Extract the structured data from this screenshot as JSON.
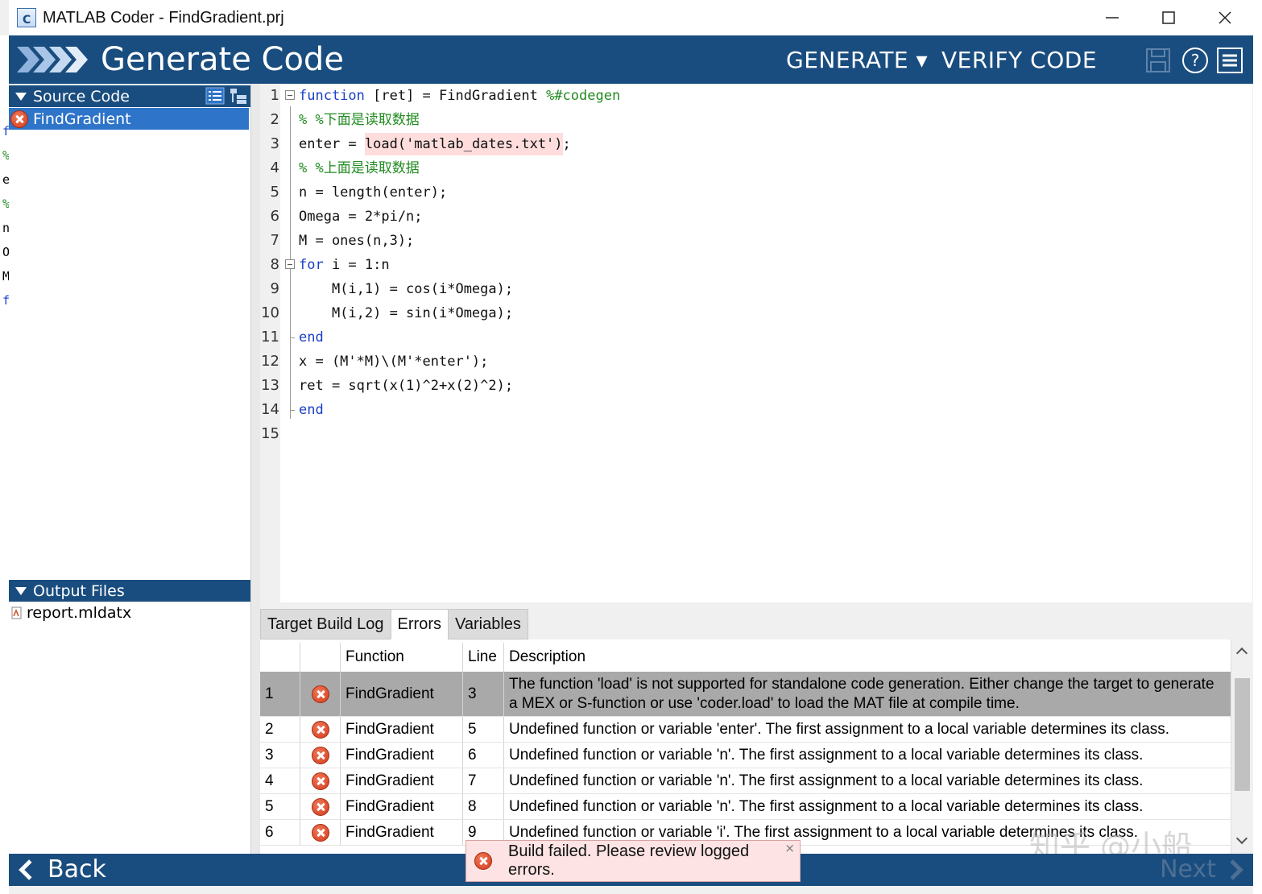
{
  "window": {
    "title": "MATLAB Coder - FindGradient.prj",
    "controls": [
      "minimize-icon",
      "maximize-icon",
      "close-icon"
    ]
  },
  "header": {
    "title": "Generate Code",
    "generate_label": "GENERATE ▾",
    "verify_label": "VERIFY CODE",
    "icons": [
      "save-icon",
      "help-icon",
      "menu-icon"
    ]
  },
  "source_code": {
    "header": "Source Code",
    "files": [
      {
        "name": "FindGradient",
        "status": "error",
        "selected": true
      }
    ]
  },
  "output_files": {
    "header": "Output Files",
    "files": [
      {
        "name": "report.mldatx"
      }
    ]
  },
  "editor": {
    "lines": [
      {
        "n": "1",
        "parts": [
          {
            "t": "function",
            "c": "kw"
          },
          {
            "t": " [ret] = FindGradient ",
            "c": ""
          },
          {
            "t": "%#codegen",
            "c": "cm"
          }
        ],
        "fold": "start"
      },
      {
        "n": "2",
        "parts": [
          {
            "t": "% %下面是读取数据",
            "c": "cm"
          }
        ]
      },
      {
        "n": "3",
        "parts": [
          {
            "t": "enter = ",
            "c": ""
          },
          {
            "t": "load('matlab_dates.txt')",
            "c": "hl"
          },
          {
            "t": ";",
            "c": ""
          }
        ]
      },
      {
        "n": "4",
        "parts": [
          {
            "t": "% %上面是读取数据",
            "c": "cm"
          }
        ]
      },
      {
        "n": "5",
        "parts": [
          {
            "t": "n = length(enter);",
            "c": ""
          }
        ]
      },
      {
        "n": "6",
        "parts": [
          {
            "t": "Omega = 2*pi/n;",
            "c": ""
          }
        ]
      },
      {
        "n": "7",
        "parts": [
          {
            "t": "M = ones(n,3);",
            "c": ""
          }
        ]
      },
      {
        "n": "8",
        "parts": [
          {
            "t": "for",
            "c": "kw"
          },
          {
            "t": " i = 1:n",
            "c": ""
          }
        ],
        "fold": "start"
      },
      {
        "n": "9",
        "parts": [
          {
            "t": "    M(i,1) = cos(i*Omega);",
            "c": ""
          }
        ]
      },
      {
        "n": "10",
        "parts": [
          {
            "t": "    M(i,2) = sin(i*Omega);",
            "c": ""
          }
        ]
      },
      {
        "n": "11",
        "parts": [
          {
            "t": "end",
            "c": "kw"
          }
        ],
        "fold": "end"
      },
      {
        "n": "12",
        "parts": [
          {
            "t": "x = (M'*M)\\(M'*enter');",
            "c": ""
          }
        ]
      },
      {
        "n": "13",
        "parts": [
          {
            "t": "ret = sqrt(x(1)^2+x(2)^2);",
            "c": ""
          }
        ]
      },
      {
        "n": "14",
        "parts": [
          {
            "t": "end",
            "c": "kw"
          }
        ],
        "fold": "end"
      },
      {
        "n": "15",
        "parts": []
      }
    ]
  },
  "bottom_panel": {
    "tabs": [
      {
        "label": "Target Build Log",
        "active": false
      },
      {
        "label": "Errors",
        "active": true
      },
      {
        "label": "Variables",
        "active": false
      }
    ],
    "columns": [
      "",
      "",
      "Function",
      "Line",
      "Description"
    ],
    "rows": [
      {
        "idx": "1",
        "function": "FindGradient",
        "line": "3",
        "description": "The function 'load' is not supported for standalone code generation. Either change the target to generate a MEX or S-function or use 'coder.load' to load the MAT file at compile time.",
        "selected": true
      },
      {
        "idx": "2",
        "function": "FindGradient",
        "line": "5",
        "description": "Undefined function or variable 'enter'. The first assignment to a local variable determines its class."
      },
      {
        "idx": "3",
        "function": "FindGradient",
        "line": "6",
        "description": "Undefined function or variable 'n'. The first assignment to a local variable determines its class."
      },
      {
        "idx": "4",
        "function": "FindGradient",
        "line": "7",
        "description": "Undefined function or variable 'n'. The first assignment to a local variable determines its class."
      },
      {
        "idx": "5",
        "function": "FindGradient",
        "line": "8",
        "description": "Undefined function or variable 'n'. The first assignment to a local variable determines its class."
      },
      {
        "idx": "6",
        "function": "FindGradient",
        "line": "9",
        "description": "Undefined function or variable 'i'. The first assignment to a local variable determines its class."
      }
    ]
  },
  "footer": {
    "back_label": "Back",
    "next_label": "Next"
  },
  "toast": {
    "message": "Build failed. Please review logged errors.",
    "close": "×"
  },
  "watermark": "知乎 @小船",
  "colors": {
    "header_bg": "#1a4d7f",
    "selection": "#2e74c9",
    "keyword": "#1a3fc9",
    "comment": "#228b22",
    "error_highlight": "#ffdddd"
  }
}
